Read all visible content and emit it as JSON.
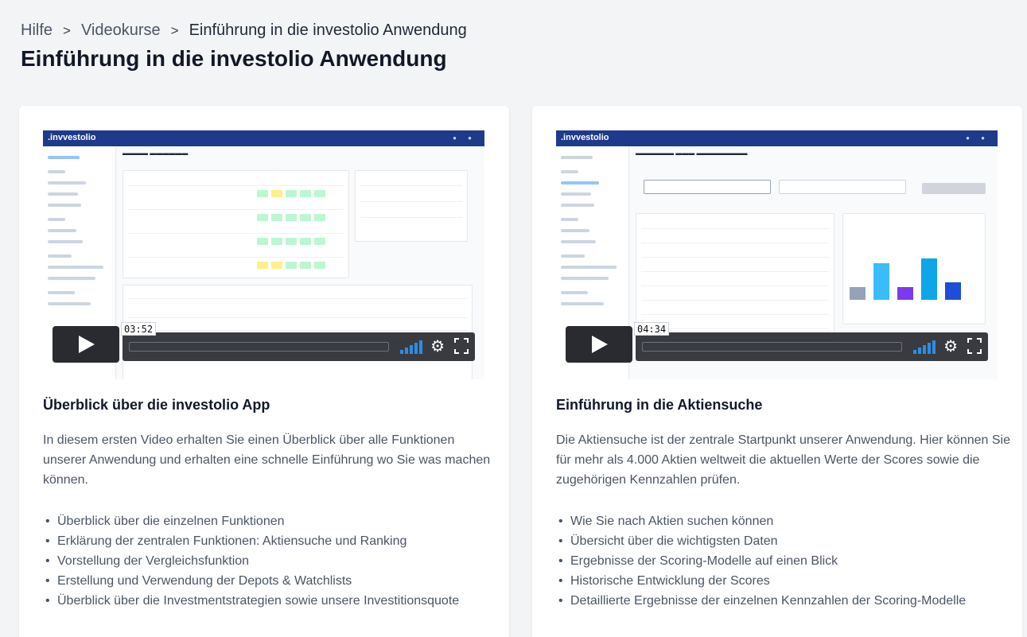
{
  "breadcrumb": {
    "items": [
      "Hilfe",
      "Videokurse",
      "Einführung in die investolio Anwendung"
    ],
    "separator": ">"
  },
  "page_title": "Einführung in die investolio Anwendung",
  "colors": {
    "player_bg": "#17191e",
    "volume_accent": "#2b8ee6",
    "app_navbar": "#1e3a8a"
  },
  "cards": [
    {
      "video": {
        "duration": "03:52",
        "preview_logo": ".invvestolio"
      },
      "title": "Überblick über die investolio App",
      "description": "In diesem ersten Video erhalten Sie einen Überblick über alle Funktionen unserer Anwendung und erhalten eine schnelle Einführung wo Sie was machen können.",
      "features": [
        "Überblick über die einzelnen Funktionen",
        "Erklärung der zentralen Funktionen: Aktiensuche und Ranking",
        "Vorstellung der Vergleichsfunktion",
        "Erstellung und Verwendung der Depots & Watchlists",
        "Überblick über die Investmentstrategien sowie unsere Investitionsquote"
      ]
    },
    {
      "video": {
        "duration": "04:34",
        "preview_logo": ".invvestolio"
      },
      "title": "Einführung in die Aktiensuche",
      "description": "Die Aktiensuche ist der zentrale Startpunkt unserer Anwendung. Hier können Sie für mehr als 4.000 Aktien weltweit die aktuellen Werte der Scores sowie die zugehörigen Kennzahlen prüfen.",
      "features": [
        "Wie Sie nach Aktien suchen können",
        "Übersicht über die wichtigsten Daten",
        "Ergebnisse der Scoring-Modelle auf einen Blick",
        "Historische Entwicklung der Scores",
        "Detaillierte Ergebnisse der einzelnen Kennzahlen der Scoring-Modelle"
      ]
    }
  ]
}
